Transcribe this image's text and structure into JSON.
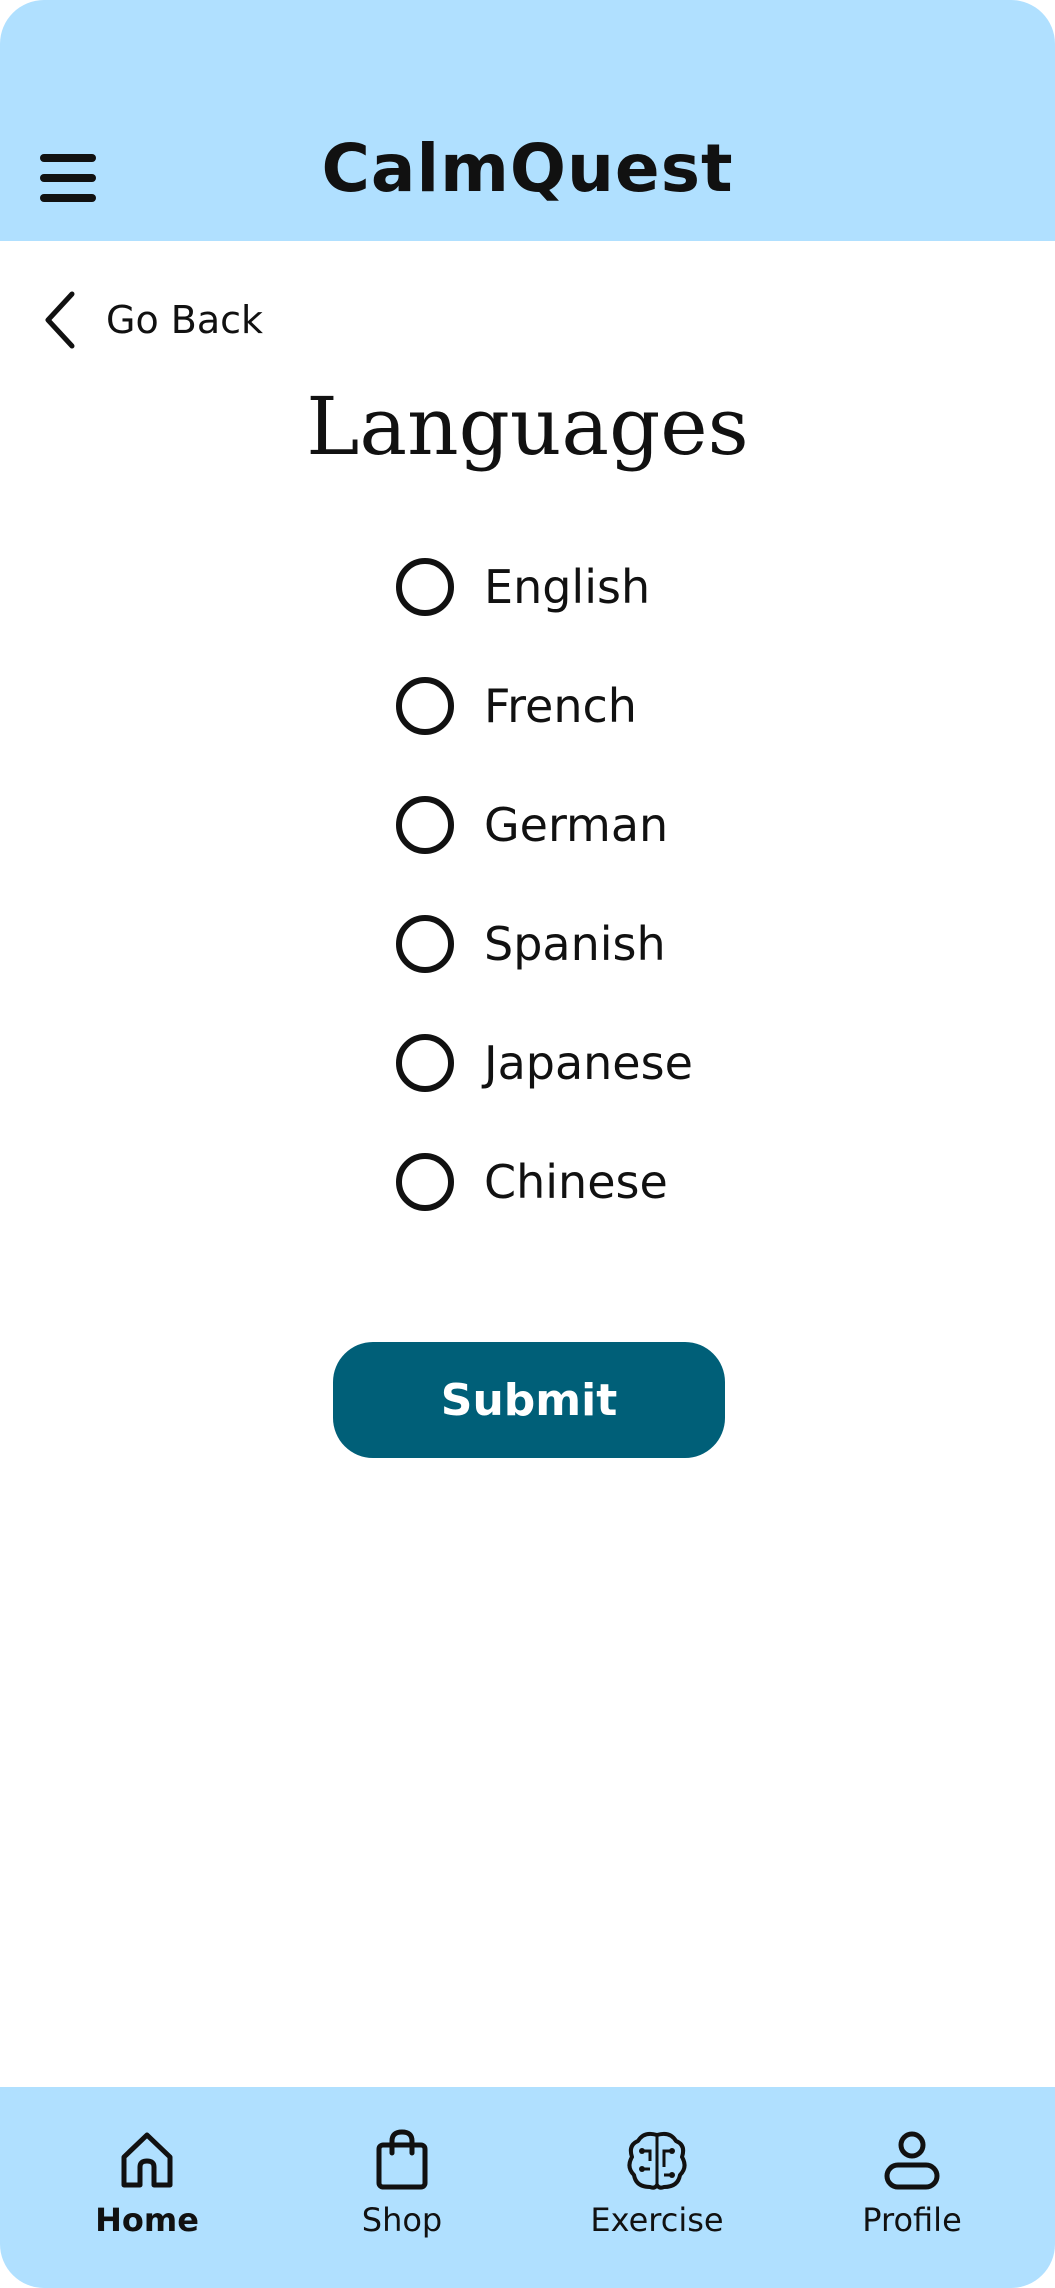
{
  "header": {
    "app_title": "CalmQuest",
    "menu_icon": "hamburger-menu-icon"
  },
  "nav": {
    "go_back_label": "Go Back",
    "back_icon": "chevron-left-icon"
  },
  "page": {
    "title": "Languages"
  },
  "languages": [
    {
      "label": "English",
      "selected": false
    },
    {
      "label": "French",
      "selected": false
    },
    {
      "label": "German",
      "selected": false
    },
    {
      "label": "Spanish",
      "selected": false
    },
    {
      "label": "Japanese",
      "selected": false
    },
    {
      "label": "Chinese",
      "selected": false
    }
  ],
  "form": {
    "submit_label": "Submit"
  },
  "bottom_nav": {
    "items": [
      {
        "label": "Home",
        "icon": "home-icon",
        "active": true
      },
      {
        "label": "Shop",
        "icon": "shopping-bag-icon",
        "active": false
      },
      {
        "label": "Exercise",
        "icon": "brain-icon",
        "active": false
      },
      {
        "label": "Profile",
        "icon": "user-icon",
        "active": false
      }
    ]
  },
  "colors": {
    "header_bg": "#b0e0ff",
    "accent_button": "#005f78",
    "text": "#111111"
  }
}
